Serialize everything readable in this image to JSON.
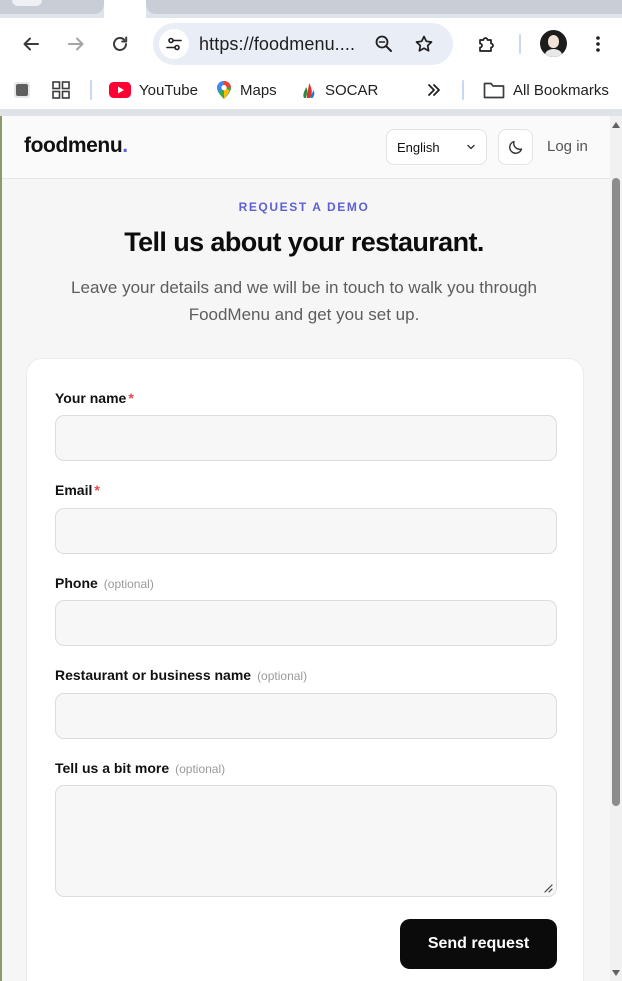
{
  "browser": {
    "url": "https://foodmenu....",
    "icons": {
      "back": "arrow-left-icon",
      "forward": "arrow-right-icon",
      "reload": "reload-icon",
      "site_info": "tune-icon",
      "zoom": "zoom-out-icon",
      "bookmark": "star-icon",
      "extensions": "puzzle-icon",
      "menu": "kebab-menu-icon"
    },
    "bookmarks": {
      "items": [
        {
          "label": "YouTube",
          "icon": "youtube-icon"
        },
        {
          "label": "Maps",
          "icon": "maps-pin-icon"
        },
        {
          "label": "SOCAR",
          "icon": "socar-flame-icon"
        }
      ],
      "overflow_icon": "chevron-double-right-icon",
      "all_bookmarks": "All Bookmarks"
    }
  },
  "header": {
    "logo": "foodmenu",
    "logo_dot": ".",
    "language": "English",
    "theme_icon": "moon-icon",
    "login": "Log in"
  },
  "hero": {
    "eyebrow": "REQUEST A DEMO",
    "title": "Tell us about your restaurant.",
    "subtitle": "Leave your details and we will be in touch to walk you through FoodMenu and get you set up."
  },
  "form": {
    "name": {
      "label": "Your name",
      "required_mark": "*",
      "value": ""
    },
    "email": {
      "label": "Email",
      "required_mark": "*",
      "value": ""
    },
    "phone": {
      "label": "Phone",
      "optional": "(optional)",
      "value": ""
    },
    "business": {
      "label": "Restaurant or business name",
      "optional": "(optional)",
      "value": ""
    },
    "more": {
      "label": "Tell us a bit more",
      "optional": "(optional)",
      "value": ""
    },
    "submit": "Send request"
  },
  "colors": {
    "accent": "#5f5fd6",
    "required": "#e5484d",
    "button": "#0b0b0b"
  }
}
